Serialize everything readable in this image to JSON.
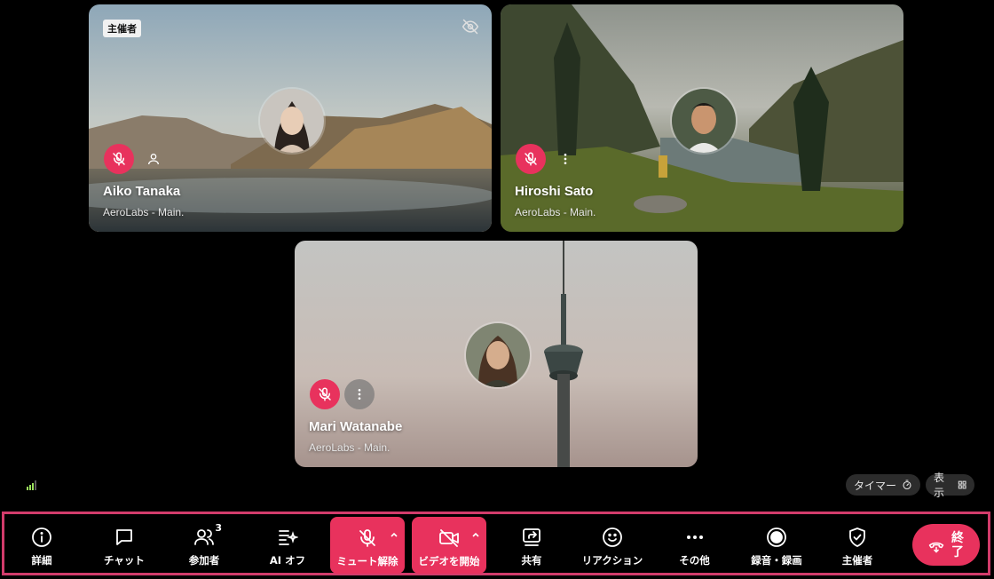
{
  "participants": [
    {
      "name": "Aiko Tanaka",
      "org": "AeroLabs - Main.",
      "badge": "主催者"
    },
    {
      "name": "Hiroshi Sato",
      "org": "AeroLabs - Main."
    },
    {
      "name": "Mari Watanabe",
      "org": "AeroLabs - Main."
    }
  ],
  "status": {
    "timer_label": "タイマー",
    "view_label": "表示"
  },
  "toolbar": {
    "details": "詳細",
    "chat": "チャット",
    "participants": "参加者",
    "participants_count": "3",
    "ai": "AI オフ",
    "unmute": "ミュート解除",
    "start_video": "ビデオを開始",
    "share": "共有",
    "reactions": "リアクション",
    "more": "その他",
    "record": "録音・録画",
    "host": "主催者",
    "end": "終了"
  },
  "colors": {
    "accent_red": "#e8325d",
    "toolbar_border": "#d23c6b"
  }
}
